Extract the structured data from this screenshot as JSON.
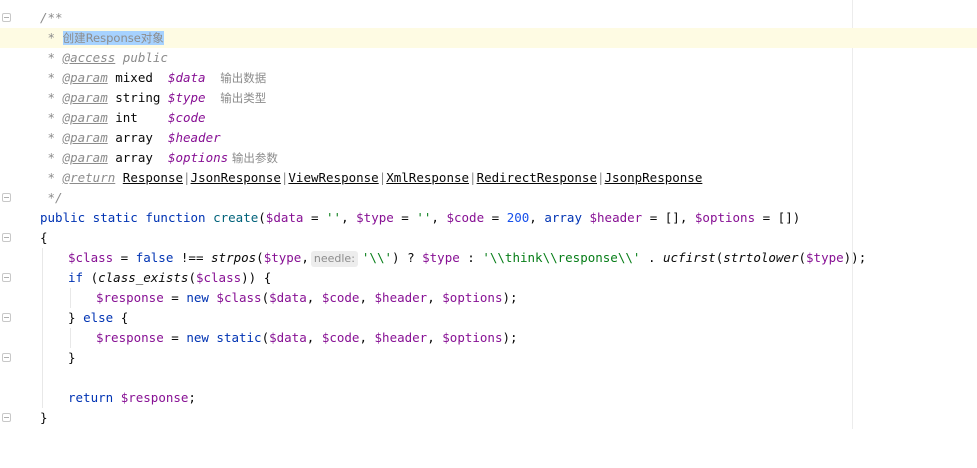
{
  "editor": {
    "doc": {
      "open": "/**",
      "summary_prefix": " * ",
      "summary": "创建Response对象",
      "access": {
        "star": " * ",
        "tag": "@access",
        "value": " public"
      },
      "param1": {
        "star": " * ",
        "tag": "@param",
        "type": " mixed  ",
        "var": "$data",
        "desc": "    输出数据"
      },
      "param2": {
        "star": " * ",
        "tag": "@param",
        "type": " string ",
        "var": "$type",
        "desc": "    输出类型"
      },
      "param3": {
        "star": " * ",
        "tag": "@param",
        "type": " int    ",
        "var": "$code"
      },
      "param4": {
        "star": " * ",
        "tag": "@param",
        "type": " array  ",
        "var": "$header"
      },
      "param5": {
        "star": " * ",
        "tag": "@param",
        "type": " array  ",
        "var": "$options",
        "desc": " 输出参数"
      },
      "return": {
        "star": " * ",
        "tag": "@return",
        "sp": " ",
        "types": [
          "Response",
          "JsonResponse",
          "ViewResponse",
          "XmlResponse",
          "RedirectResponse",
          "JsonpResponse"
        ],
        "sep": "|"
      },
      "close": " */"
    },
    "code": {
      "sig": {
        "kw1": "public",
        "kw2": " static",
        "kw3": " function",
        "name": " create",
        "p1": "(",
        "v1": "$data",
        "e1": " = ",
        "s1": "''",
        "c1": ", ",
        "v2": "$type",
        "e2": " = ",
        "s2": "''",
        "c2": ", ",
        "v3": "$code",
        "e3": " = ",
        "n3": "200",
        "c3": ", ",
        "kw4": "array",
        "v4": " $header",
        "e4": " = [], ",
        "v5": "$options",
        "e5": " = [])"
      },
      "open_brace": "{",
      "l1": {
        "v1": "$class",
        "t1": " = ",
        "kw1": "false",
        "t2": " !== ",
        "fn1": "strpos",
        "t3": "(",
        "v2": "$type",
        "t4": ",",
        "hint": "needle:",
        "s1": "'\\\\'",
        "t5": ") ? ",
        "v3": "$type",
        "t6": " : ",
        "s2a": "'\\\\",
        "s2b": "think",
        "s2c": "\\\\",
        "s2d": "response",
        "s2e": "\\\\'",
        "t7": " . ",
        "fn2": "ucfirst",
        "t8": "(",
        "fn3": "strtolower",
        "t9": "(",
        "v4": "$type",
        "t10": "));"
      },
      "l2": {
        "kw": "if",
        "t1": " (",
        "fn": "class_exists",
        "t2": "(",
        "v": "$class",
        "t3": ")) {"
      },
      "l3": {
        "v1": "$response",
        "t1": " = ",
        "kw": "new",
        "t2": " ",
        "v2": "$class",
        "t3": "(",
        "v3": "$data",
        "t4": ", ",
        "v4": "$code",
        "t5": ", ",
        "v5": "$header",
        "t6": ", ",
        "v6": "$options",
        "t7": ");"
      },
      "l4": {
        "t1": "} ",
        "kw": "else",
        "t2": " {"
      },
      "l5": {
        "v1": "$response",
        "t1": " = ",
        "kw1": "new",
        "kw2": " static",
        "t3": "(",
        "v3": "$data",
        "t4": ", ",
        "v4": "$code",
        "t5": ", ",
        "v5": "$header",
        "t6": ", ",
        "v6": "$options",
        "t7": ");"
      },
      "l6": {
        "t": "}"
      },
      "l8": {
        "kw": "return",
        "t1": " ",
        "v": "$response",
        "t2": ";"
      },
      "close_brace": "}"
    }
  }
}
